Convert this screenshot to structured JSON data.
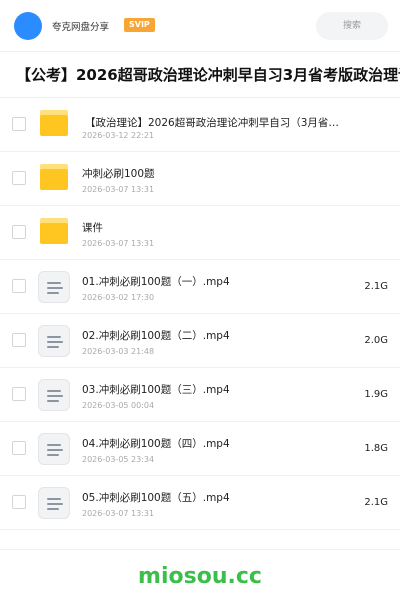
{
  "header": {
    "app_name": "夸克网盘分享",
    "badge": "SVIP",
    "search_placeholder": "搜索"
  },
  "title": "【公考】2026超哥政治理论冲刺早自习3月省考版政治理论",
  "items": [
    {
      "type": "folder",
      "name": "【政治理论】2026超哥政治理论冲刺早自习（3月省…",
      "date": "2026-03-12 22:21",
      "size": ""
    },
    {
      "type": "folder",
      "name": "冲刺必刷100题",
      "date": "2026-03-07 13:31",
      "size": ""
    },
    {
      "type": "folder",
      "name": "课件",
      "date": "2026-03-07 13:31",
      "size": ""
    },
    {
      "type": "file",
      "name": "01.冲刺必刷100题（一）.mp4",
      "date": "2026-03-02 17:30",
      "size": "2.1G"
    },
    {
      "type": "file",
      "name": "02.冲刺必刷100题（二）.mp4",
      "date": "2026-03-03 21:48",
      "size": "2.0G"
    },
    {
      "type": "file",
      "name": "03.冲刺必刷100题（三）.mp4",
      "date": "2026-03-05 00:04",
      "size": "1.9G"
    },
    {
      "type": "file",
      "name": "04.冲刺必刷100题（四）.mp4",
      "date": "2026-03-05 23:34",
      "size": "1.8G"
    },
    {
      "type": "file",
      "name": "05.冲刺必刷100题（五）.mp4",
      "date": "2026-03-07 13:31",
      "size": "2.1G"
    }
  ],
  "watermark": "miosou.cc",
  "colors": {
    "accent": "#2b8cff",
    "badge": "#f7a534",
    "folder": "#ffc520",
    "watermark": "#3cbf4a"
  }
}
